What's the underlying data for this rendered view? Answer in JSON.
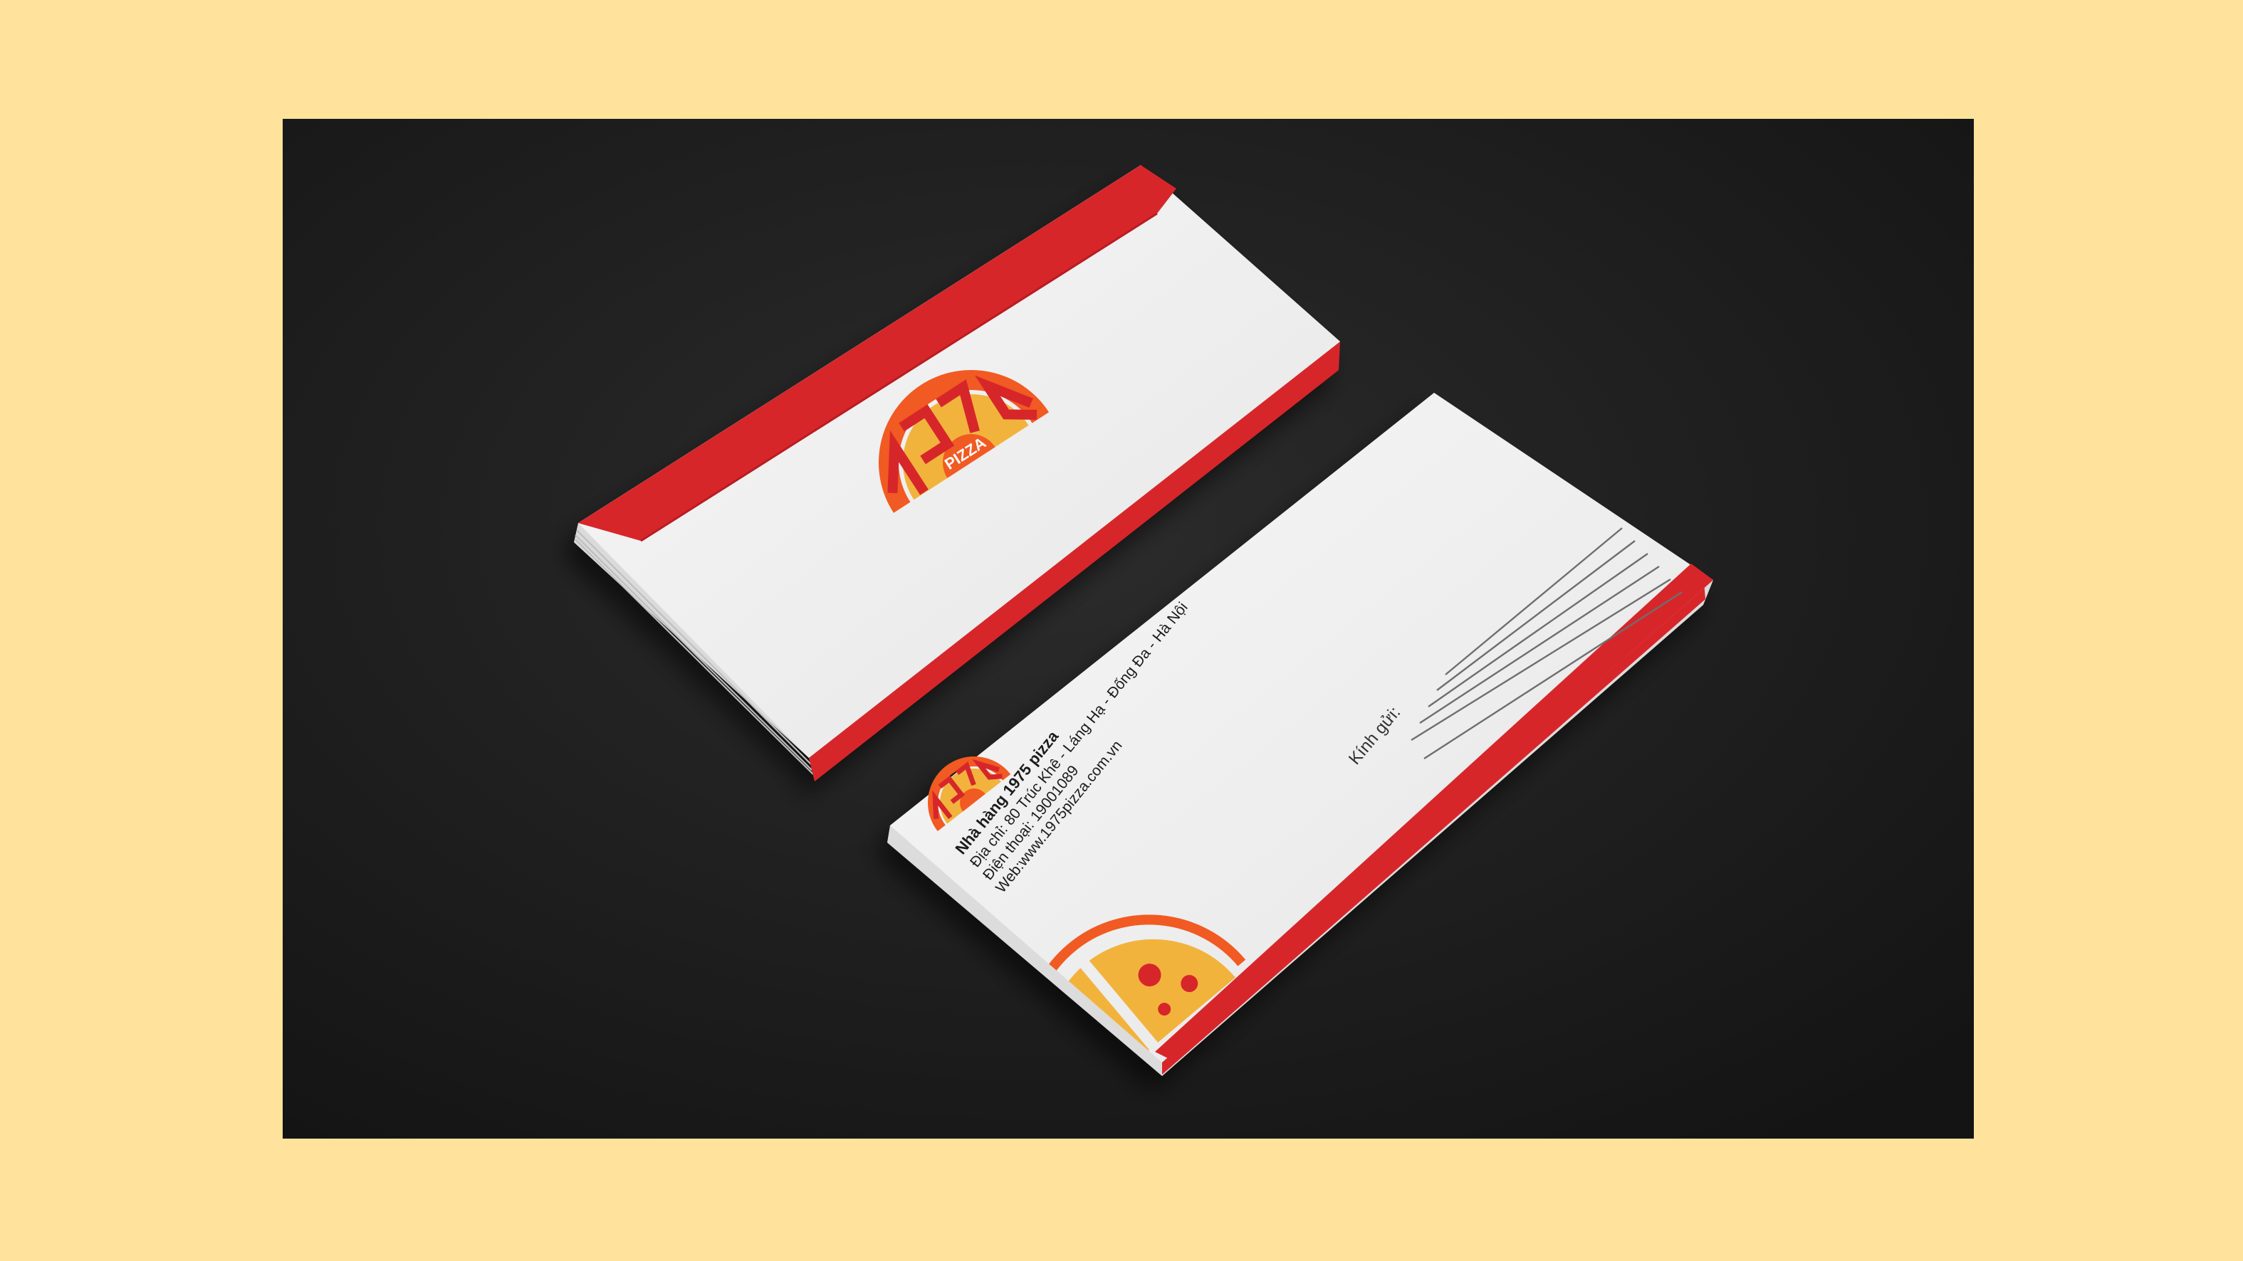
{
  "colors": {
    "frame": "#FFE39C",
    "backdrop": "#1E1E1E",
    "brand_red": "#D7262C",
    "logo_orange": "#F15A24",
    "logo_yellow": "#F2B33D",
    "paper": "#F2F2F2"
  },
  "back_envelope": {
    "logo": {
      "name": "1975 pizza logo",
      "number": "1975",
      "word": "PIZZA"
    }
  },
  "front_envelope": {
    "sender": {
      "name_line": "Nhà hàng 1975 pizza",
      "address_line": "Địa chỉ: 80 Trúc Khê - Láng Hạ - Đống Đa - Hà Nội",
      "phone_line": "Điện thoại: 19001089",
      "web_line": "Web:www.1975pizza.com.vn"
    },
    "recipient_label": "Kính gửi:",
    "decor": "pizza-slice-icon"
  }
}
